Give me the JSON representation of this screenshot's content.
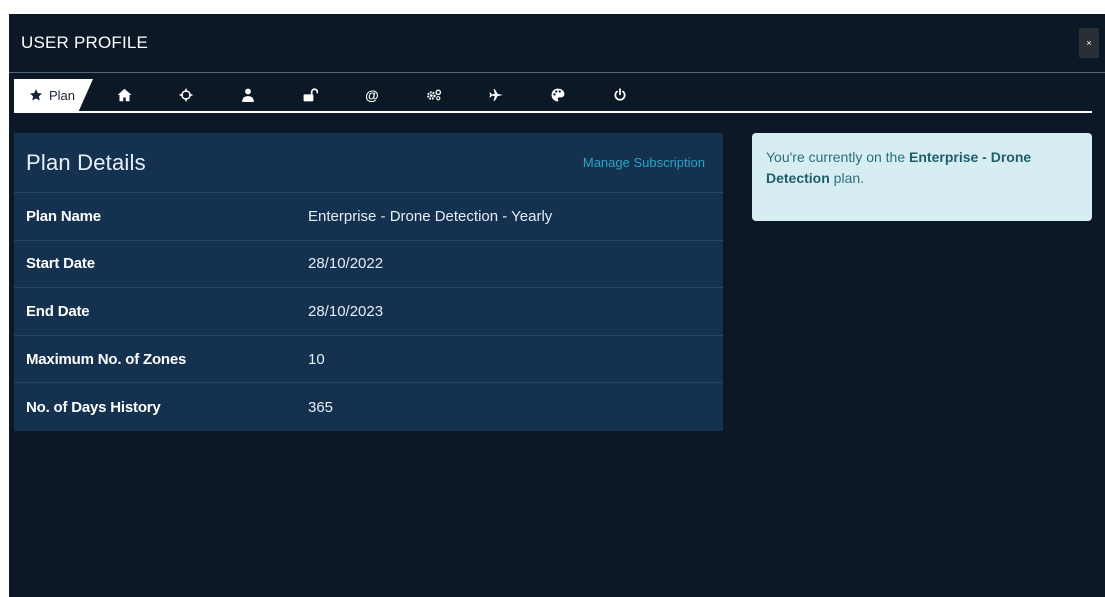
{
  "header": {
    "title": "USER PROFILE",
    "close_label": "×"
  },
  "tabs": [
    {
      "label": "Plan",
      "icon": "star-icon",
      "active": true
    },
    {
      "label": "",
      "icon": "home-icon"
    },
    {
      "label": "",
      "icon": "crosshair-icon"
    },
    {
      "label": "",
      "icon": "user-icon"
    },
    {
      "label": "",
      "icon": "unlock-icon"
    },
    {
      "label": "",
      "icon": "at-icon"
    },
    {
      "label": "",
      "icon": "cogs-icon"
    },
    {
      "label": "",
      "icon": "plane-icon"
    },
    {
      "label": "",
      "icon": "palette-icon"
    },
    {
      "label": "",
      "icon": "power-icon"
    }
  ],
  "plan": {
    "title": "Plan Details",
    "manage_label": "Manage Subscription",
    "rows": [
      {
        "label": "Plan Name",
        "value": "Enterprise - Drone Detection - Yearly"
      },
      {
        "label": "Start Date",
        "value": "28/10/2022"
      },
      {
        "label": "End Date",
        "value": "28/10/2023"
      },
      {
        "label": "Maximum No. of Zones",
        "value": "10"
      },
      {
        "label": "No. of Days History",
        "value": "365"
      }
    ]
  },
  "alert": {
    "prefix": "You're currently on the ",
    "plan_name": "Enterprise - Drone Detection",
    "suffix": " plan."
  },
  "colors": {
    "background": "#0c1826",
    "panel": "#14314f",
    "accent_link": "#2aa3c7",
    "alert_bg": "#d6eef2",
    "alert_text": "#2a6e7e"
  }
}
